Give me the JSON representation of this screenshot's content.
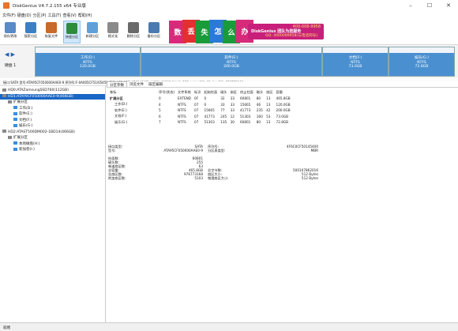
{
  "title": "DiskGenius V4.7.2.155 x64 专业版",
  "window_controls": [
    "–",
    "☐",
    "✕"
  ],
  "menu": [
    "文件(F)",
    "硬盘(D)",
    "分区(P)",
    "工具(T)",
    "查看(V)",
    "帮助(H)"
  ],
  "toolbar": [
    {
      "label": "保存更改",
      "color": "#5a8ac8"
    },
    {
      "label": "搜索分区",
      "color": "#3c7fc4"
    },
    {
      "label": "恢复文件",
      "color": "#c86a2a"
    },
    {
      "label": "快速分区",
      "color": "#2e8b3e"
    },
    {
      "label": "新建分区",
      "color": "#5fa0d8"
    },
    {
      "label": "格式化",
      "color": "#8a8a8a"
    },
    {
      "label": "删除分区",
      "color": "#6a6a6a"
    },
    {
      "label": "备份分区",
      "color": "#4a7ab0"
    }
  ],
  "banner": {
    "tiles": [
      {
        "text": "数",
        "color": "#d82a7a"
      },
      {
        "text": "丢",
        "color": "#e23030"
      },
      {
        "text": "失",
        "color": "#1a9b3a"
      },
      {
        "text": "怎",
        "color": "#2a7ad8"
      },
      {
        "text": "么",
        "color": "#1a9b3a"
      },
      {
        "text": "办",
        "color": "#d82a7a"
      }
    ],
    "brand": "DiskGenius",
    "slogan": "团队为您服务",
    "phone": "400-008-9958",
    "qq": "QQ: 4000089958(与电话同号)"
  },
  "disk_nav": "◀ ▶",
  "disk_map": {
    "label": "硬盘 1",
    "partitions": [
      {
        "name": "工作(D:)",
        "fs": "NTFS",
        "size": "120.0GB"
      },
      {
        "name": "软件(E:)",
        "fs": "NTFS",
        "size": "200.0GB"
      },
      {
        "name": "文档(F:)",
        "fs": "NTFS",
        "size": "73.0GB"
      },
      {
        "name": "娱乐(G:)",
        "fs": "NTFS",
        "size": "72.8GB"
      }
    ]
  },
  "disk_info": "接口:SATA  型号:ATA95CF050000AAE0-9  序列号:F-0A005CF51/05450  容量:465.8GB(476940MB)  柱面数:60801  磁头数:255  每道扇区数:63  总扇区数:976773168",
  "tree": [
    {
      "text": "HD0:ATAZamsungSSD760(112GB)",
      "level": 0,
      "sel": false,
      "part": false
    },
    {
      "text": "HD1:ATAY9CF050000AAE0-9(466GB)",
      "level": 0,
      "sel": true,
      "part": false
    },
    {
      "text": "扩展分区",
      "level": 1,
      "sel": false,
      "part": false
    },
    {
      "text": "工作(D:)",
      "level": 2,
      "sel": false,
      "part": true
    },
    {
      "text": "软件(E:)",
      "level": 2,
      "sel": false,
      "part": true
    },
    {
      "text": "文档(F:)",
      "level": 2,
      "sel": false,
      "part": true
    },
    {
      "text": "娱乐(G:)",
      "level": 2,
      "sel": false,
      "part": true
    },
    {
      "text": "HD2:ATAST500DM002-1BD14(466GB)",
      "level": 0,
      "sel": false,
      "part": false
    },
    {
      "text": "扩展分区",
      "level": 1,
      "sel": false,
      "part": false
    },
    {
      "text": "本地磁盘(H:)",
      "level": 2,
      "sel": false,
      "part": true
    },
    {
      "text": "新加卷(I:)",
      "level": 2,
      "sel": false,
      "part": true
    }
  ],
  "tabs": [
    "分区参数",
    "浏览文件",
    "扇区编辑"
  ],
  "table": {
    "headers": [
      "卷标",
      "序号(状态)",
      "文件系统",
      "标识",
      "起始柱面",
      "磁头",
      "扇区",
      "终止柱面",
      "磁头",
      "扇区",
      "容量"
    ],
    "rows": [
      {
        "cells": [
          "扩展分区",
          "0",
          "EXTEND",
          "0F",
          "0",
          "32",
          "33",
          "60801",
          "80",
          "13",
          "465.8GB"
        ],
        "bold": true
      },
      {
        "cells": [
          "工作(D:)",
          "4",
          "NTFS",
          "07",
          "0",
          "33",
          "33",
          "15665",
          "46",
          "13",
          "120.0GB"
        ],
        "bold": false
      },
      {
        "cells": [
          "软件(E:)",
          "5",
          "NTFS",
          "07",
          "15665",
          "77",
          "33",
          "41773",
          "235",
          "42",
          "200.0GB"
        ],
        "bold": false
      },
      {
        "cells": [
          "文档(F:)",
          "6",
          "NTFS",
          "07",
          "41773",
          "245",
          "12",
          "51303",
          "160",
          "53",
          "73.0GB"
        ],
        "bold": false
      },
      {
        "cells": [
          "娱乐(G:)",
          "7",
          "NTFS",
          "07",
          "51303",
          "135",
          "30",
          "60801",
          "80",
          "13",
          "72.8GB"
        ],
        "bold": false
      }
    ]
  },
  "fs_info": {
    "left": [
      [
        "接口类型:",
        "SATA"
      ],
      [
        "型号:",
        "ATA95CF050000AAE0-9"
      ],
      [
        "",
        ""
      ],
      [
        "柱面数:",
        "60801"
      ],
      [
        "磁头数:",
        "255"
      ],
      [
        "每道扇区数:",
        "63"
      ],
      [
        "总容量:",
        "465.8GB"
      ],
      [
        "总扇区数:",
        "976773168"
      ],
      [
        "附加扇区数:",
        "5103"
      ]
    ],
    "right": [
      [
        "序列号:",
        "4F6C0CF50145400"
      ],
      [
        "分区表类型:",
        "MBR"
      ],
      [
        "",
        ""
      ],
      [
        "",
        ""
      ],
      [
        "",
        ""
      ],
      [
        "",
        ""
      ],
      [
        "总字节数:",
        "500107862016"
      ],
      [
        "扇区大小:",
        "512 Bytes"
      ],
      [
        "物理扇区大小:",
        "512 Bytes"
      ]
    ]
  },
  "status": "就绪"
}
